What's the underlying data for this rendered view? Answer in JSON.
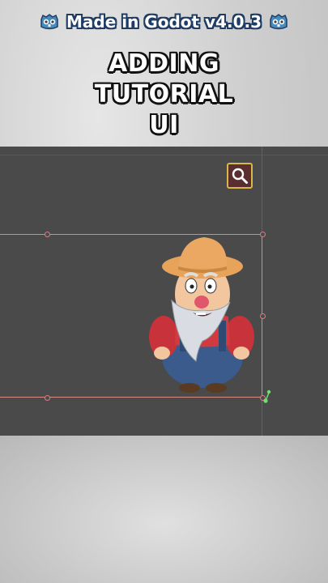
{
  "banner": {
    "text": "Made in Godot v4.0.3",
    "left_icon": "godot-logo-icon",
    "right_icon": "godot-logo-icon"
  },
  "title": {
    "line1": "ADDING",
    "line2": "TUTORIAL",
    "line3": "UI"
  },
  "viewport": {
    "search_button_icon": "magnifier-icon",
    "character_icon": "old-farmer-character",
    "colors": {
      "background": "#4a4a4a",
      "selection": "#d88a80",
      "search_border": "#d8b84a",
      "search_fill": "#5a2e2e"
    }
  }
}
